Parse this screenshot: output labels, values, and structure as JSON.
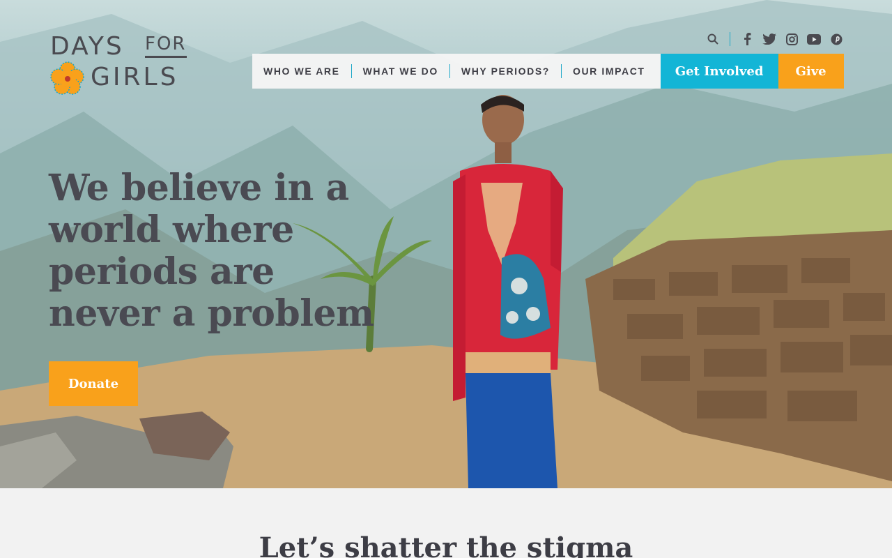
{
  "brand": {
    "logo_line1": "DAYS",
    "logo_for": "FOR",
    "logo_line2": "GIRLS"
  },
  "social": {
    "icons": [
      "search-icon",
      "facebook-icon",
      "twitter-icon",
      "instagram-icon",
      "youtube-icon",
      "pinterest-icon"
    ]
  },
  "nav": {
    "items": [
      {
        "label": "WHO WE ARE"
      },
      {
        "label": "WHAT WE DO"
      },
      {
        "label": "WHY PERIODS?"
      },
      {
        "label": "OUR IMPACT"
      }
    ],
    "get_involved": "Get Involved",
    "give": "Give"
  },
  "hero": {
    "headline": "We believe in a world where periods are never a problem",
    "donate_label": "Donate"
  },
  "section": {
    "title": "Let’s shatter the stigma"
  },
  "colors": {
    "accent_blue": "#13b5d6",
    "accent_orange": "#f9a11b",
    "text_dark": "#4a4a52"
  }
}
